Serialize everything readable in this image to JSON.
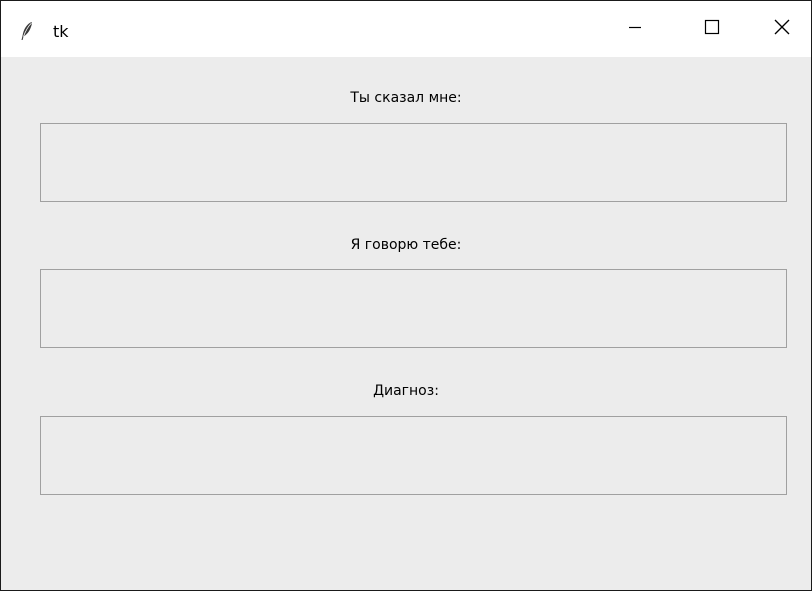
{
  "window": {
    "title": "tk",
    "icon": "feather-icon",
    "controls": [
      "minimize-icon",
      "maximize-icon",
      "close-icon"
    ]
  },
  "fields": [
    {
      "label": "Ты сказал мне:",
      "value": ""
    },
    {
      "label": "Я говорю тебе:",
      "value": ""
    },
    {
      "label": "Диагноз:",
      "value": ""
    }
  ],
  "colors": {
    "background": "#ececec",
    "titlebar": "#ffffff",
    "field_border": "#a0a0a0"
  }
}
